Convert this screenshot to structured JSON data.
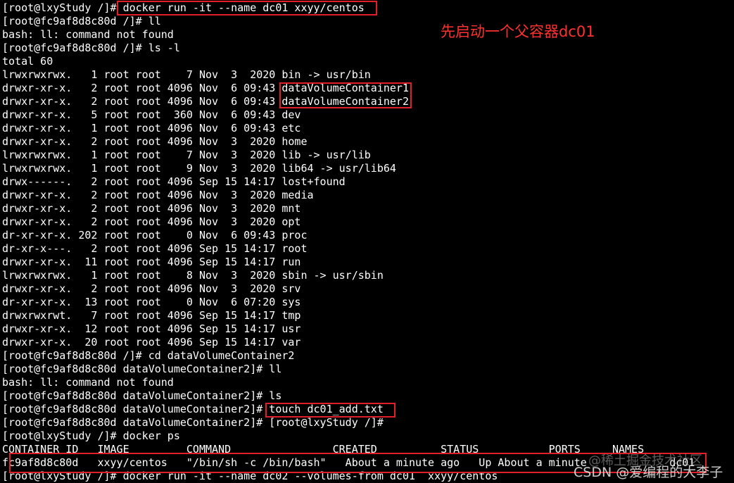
{
  "terminal": {
    "lines": [
      "[root@lxyStudy /]# docker run -it --name dc01 xxyy/centos",
      "[root@fc9af8d8c80d /]# ll",
      "bash: ll: command not found",
      "[root@fc9af8d8c80d /]# ls -l",
      "total 60",
      "lrwxrwxrwx.   1 root root    7 Nov  3  2020 bin -> usr/bin",
      "drwxr-xr-x.   2 root root 4096 Nov  6 09:43 dataVolumeContainer1",
      "drwxr-xr-x.   2 root root 4096 Nov  6 09:43 dataVolumeContainer2",
      "drwxr-xr-x.   5 root root  360 Nov  6 09:43 dev",
      "drwxr-xr-x.   1 root root 4096 Nov  6 09:43 etc",
      "drwxr-xr-x.   2 root root 4096 Nov  3  2020 home",
      "lrwxrwxrwx.   1 root root    7 Nov  3  2020 lib -> usr/lib",
      "lrwxrwxrwx.   1 root root    9 Nov  3  2020 lib64 -> usr/lib64",
      "drwx------.   2 root root 4096 Sep 15 14:17 lost+found",
      "drwxr-xr-x.   2 root root 4096 Nov  3  2020 media",
      "drwxr-xr-x.   2 root root 4096 Nov  3  2020 mnt",
      "drwxr-xr-x.   2 root root 4096 Nov  3  2020 opt",
      "dr-xr-xr-x. 202 root root    0 Nov  6 09:43 proc",
      "dr-xr-x---.   2 root root 4096 Sep 15 14:17 root",
      "drwxr-xr-x.  11 root root 4096 Sep 15 14:17 run",
      "lrwxrwxrwx.   1 root root    8 Nov  3  2020 sbin -> usr/sbin",
      "drwxr-xr-x.   2 root root 4096 Nov  3  2020 srv",
      "dr-xr-xr-x.  13 root root    0 Nov  6 07:20 sys",
      "drwxrwxrwt.   7 root root 4096 Sep 15 14:17 tmp",
      "drwxr-xr-x.  12 root root 4096 Sep 15 14:17 usr",
      "drwxr-xr-x.  20 root root 4096 Sep 15 14:17 var",
      "[root@fc9af8d8c80d /]# cd dataVolumeContainer2",
      "[root@fc9af8d8c80d dataVolumeContainer2]# ll",
      "bash: ll: command not found",
      "[root@fc9af8d8c80d dataVolumeContainer2]# ls",
      "[root@fc9af8d8c80d dataVolumeContainer2]# touch dc01_add.txt",
      "[root@fc9af8d8c80d dataVolumeContainer2]# [root@lxyStudy /]#",
      "[root@lxyStudy /]# docker ps",
      "CONTAINER ID   IMAGE         COMMAND                CREATED          STATUS           PORTS     NAMES",
      "fc9af8d8c80d   xxyy/centos   \"/bin/sh -c /bin/bash\"   About a minute ago   Up About a minute             dc01",
      "[root@lxyStudy /]# docker run -it --name dc02 --volumes-from dc01  xxyy/centos"
    ]
  },
  "annotation": "先启动一个父容器dc01",
  "watermark": {
    "line1": "@稀土掘金技术社区",
    "line2": "CSDN @爱编程的大李子"
  },
  "colors": {
    "background": "#000000",
    "text": "#ffffff",
    "highlight_border": "#e01f2a",
    "annotation": "#ff3131"
  }
}
